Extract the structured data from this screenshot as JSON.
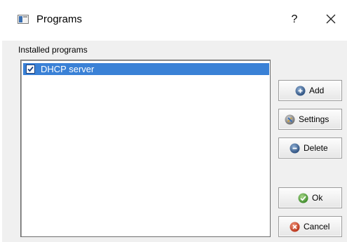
{
  "window": {
    "title": "Programs",
    "help_label": "?",
    "close_icon": "close-icon"
  },
  "main": {
    "group_label": "Installed programs",
    "programs": [
      {
        "label": "DHCP server",
        "checked": true,
        "selected": true
      }
    ]
  },
  "buttons": {
    "add": {
      "label": "Add",
      "icon": "add-icon"
    },
    "settings": {
      "label": "Settings",
      "icon": "settings-icon"
    },
    "delete": {
      "label": "Delete",
      "icon": "delete-icon"
    },
    "ok": {
      "label": "Ok",
      "icon": "ok-icon"
    },
    "cancel": {
      "label": "Cancel",
      "icon": "cancel-icon"
    }
  },
  "colors": {
    "selection": "#3a81d6",
    "client_background": "#f0f0f0"
  }
}
